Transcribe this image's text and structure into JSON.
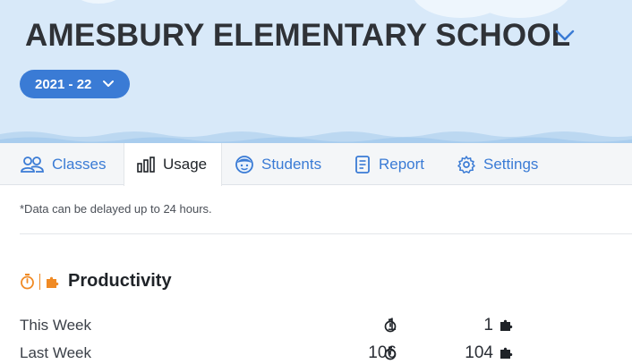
{
  "header": {
    "school_name": "AMESBURY ELEMENTARY SCHOOL",
    "school_year": "2021 - 22"
  },
  "tabs": [
    {
      "label": "Classes",
      "icon": "users-icon",
      "active": false
    },
    {
      "label": "Usage",
      "icon": "bar-chart-icon",
      "active": true
    },
    {
      "label": "Students",
      "icon": "student-face-icon",
      "active": false
    },
    {
      "label": "Report",
      "icon": "report-icon",
      "active": false
    },
    {
      "label": "Settings",
      "icon": "gear-icon",
      "active": false
    }
  ],
  "note": "*Data can be delayed up to 24 hours.",
  "productivity": {
    "title": "Productivity",
    "rows": [
      {
        "label": "This Week",
        "time_value": "1",
        "puzzle_value": "1"
      },
      {
        "label": "Last Week",
        "time_value": "106",
        "puzzle_value": "104"
      }
    ]
  },
  "colors": {
    "accent": "#3a7bd5",
    "hero_bg": "#d8e9f9",
    "productivity_orange": "#f08a24"
  }
}
